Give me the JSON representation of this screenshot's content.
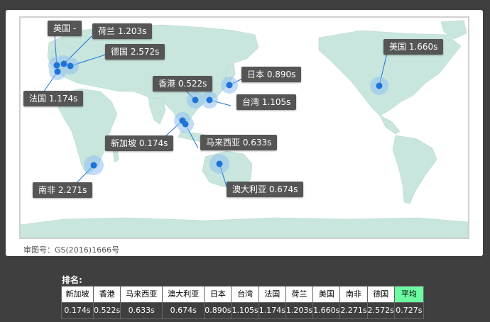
{
  "map": {
    "approval_number": "审图号：GS(2016)1666号",
    "labels": {
      "uk": "英国 -",
      "netherlands": "荷兰 1.203s",
      "germany": "德国 2.572s",
      "france": "法国 1.174s",
      "usa": "美国 1.660s",
      "japan": "日本 0.890s",
      "hongkong": "香港 0.522s",
      "taiwan": "台湾 1.105s",
      "singapore": "新加坡 0.174s",
      "malaysia": "马来西亚 0.633s",
      "southafrica": "南非 2.271s",
      "australia": "澳大利亚 0.674s"
    },
    "colors": {
      "land": "#c9e6de",
      "marker": "#1e73d6",
      "halo": "#8fc1f1",
      "callout_bg": "#555555"
    }
  },
  "ranking": {
    "title": "排名:",
    "columns": [
      "新加坡",
      "香港",
      "马来西亚",
      "澳大利亚",
      "日本",
      "台湾",
      "法国",
      "荷兰",
      "美国",
      "南非",
      "德国",
      "平均"
    ],
    "values": [
      "0.174s",
      "0.522s",
      "0.633s",
      "0.674s",
      "0.890s",
      "1.105s",
      "1.174s",
      "1.203s",
      "1.660s",
      "2.271s",
      "2.572s",
      "0.727s"
    ],
    "highlight_color": "#6dfba1"
  }
}
